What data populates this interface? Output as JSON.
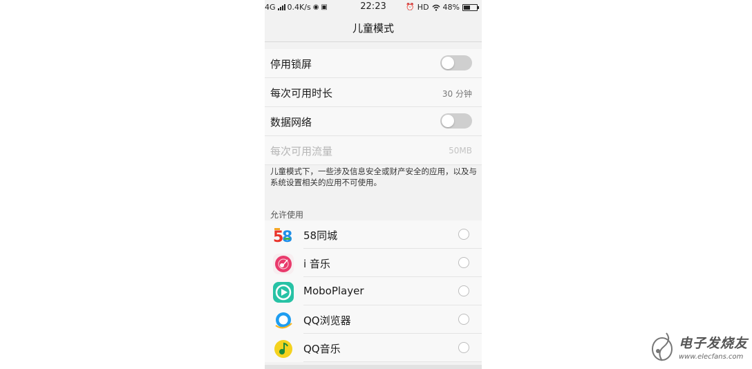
{
  "status_bar": {
    "network": "4G",
    "speed": "0.4K/s",
    "time": "22:23",
    "hd": "HD",
    "battery_percent": "48%",
    "battery_level": 0.48
  },
  "header": {
    "title": "儿童模式"
  },
  "settings": [
    {
      "label": "停用锁屏",
      "control": "toggle",
      "on": false
    },
    {
      "label": "每次可用时长",
      "value": "30 分钟"
    },
    {
      "label": "数据网络",
      "control": "toggle",
      "on": false
    },
    {
      "label": "每次可用流量",
      "value": "50MB",
      "disabled": true
    }
  ],
  "note": "儿童模式下，一些涉及信息安全或财产安全的应用，以及与系统设置相关的应用不可使用。",
  "allowed_section": {
    "title": "允许使用",
    "apps": [
      {
        "name": "58同城",
        "icon": "58-tongcheng-icon",
        "selected": false
      },
      {
        "name": "i 音乐",
        "icon": "i-music-icon",
        "selected": false
      },
      {
        "name": "MoboPlayer",
        "icon": "moboplayer-icon",
        "selected": false
      },
      {
        "name": "QQ浏览器",
        "icon": "qq-browser-icon",
        "selected": false
      },
      {
        "name": "QQ音乐",
        "icon": "qq-music-icon",
        "selected": false
      }
    ]
  },
  "watermark": {
    "text": "电子发烧友",
    "url": "www.elecfans.com"
  },
  "colors": {
    "toggle_off": "#cfcfcf",
    "background": "#f2f2f2",
    "row_bg": "#f8f8f8"
  }
}
